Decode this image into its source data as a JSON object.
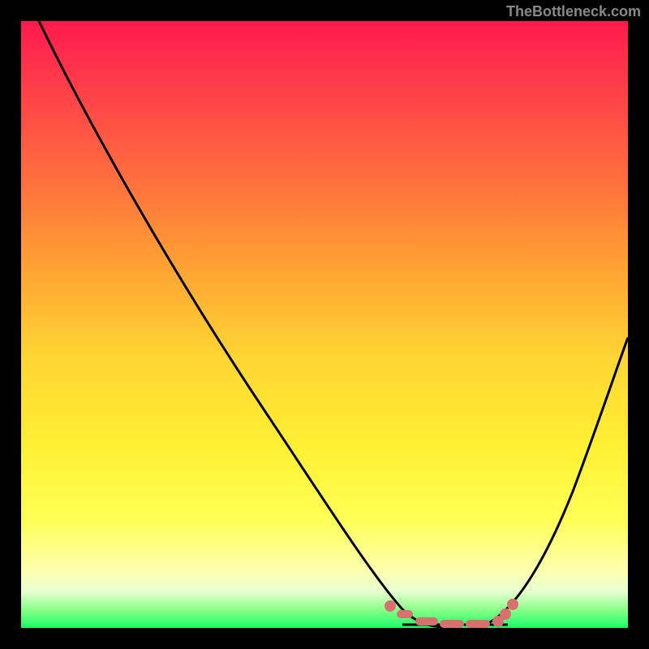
{
  "watermark": "TheBottleneck.com",
  "chart_data": {
    "type": "line",
    "title": "",
    "xlabel": "",
    "ylabel": "",
    "xlim": [
      0,
      100
    ],
    "ylim": [
      0,
      100
    ],
    "series": [
      {
        "name": "curve",
        "x": [
          3,
          10,
          20,
          30,
          40,
          50,
          58,
          62,
          68,
          75,
          80,
          85,
          90,
          95,
          100
        ],
        "y": [
          100,
          88,
          72,
          56,
          40,
          24,
          10,
          4,
          0,
          0,
          4,
          12,
          24,
          38,
          52
        ]
      }
    ],
    "optimal_band": {
      "x_start": 58,
      "x_end": 80,
      "y": 2
    },
    "background_gradient": [
      "#ff1a4d",
      "#ffa033",
      "#ffff55",
      "#1aff66"
    ]
  }
}
